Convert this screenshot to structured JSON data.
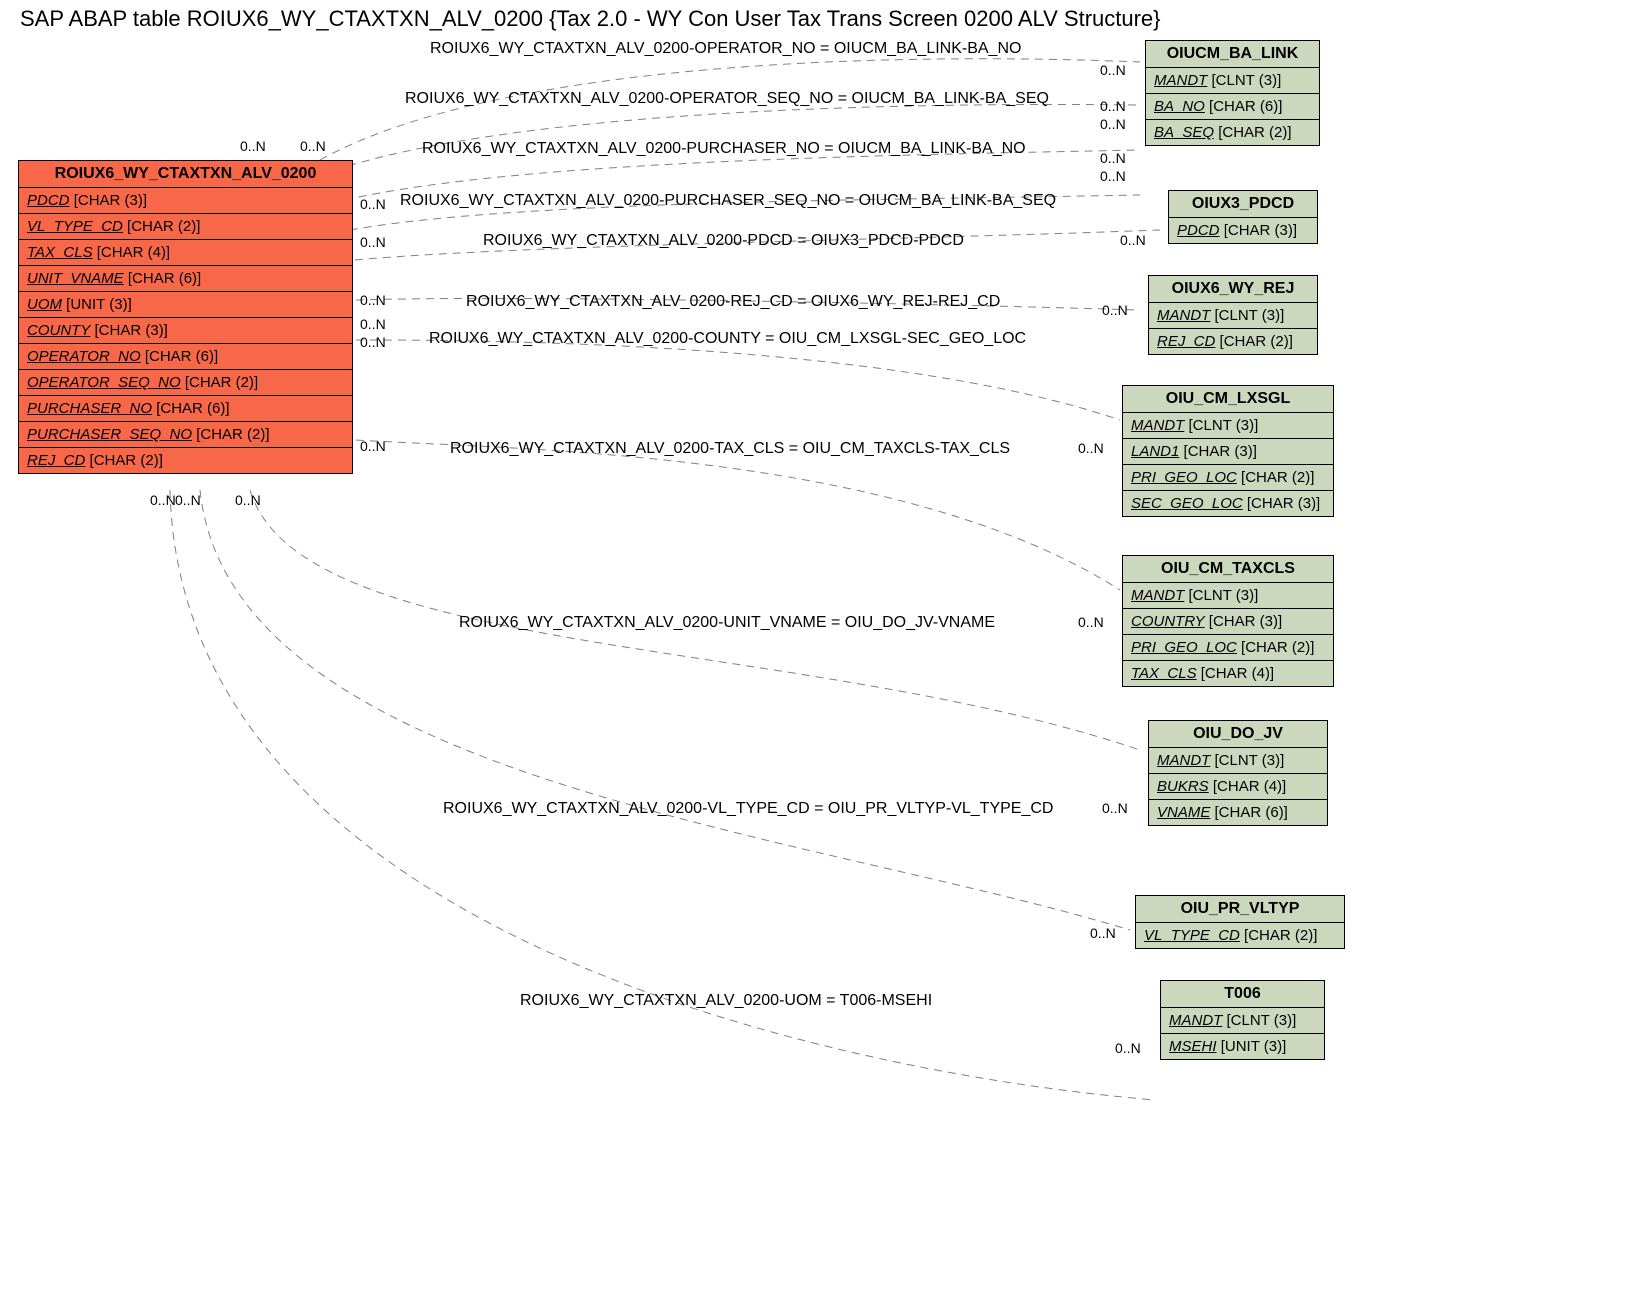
{
  "title": "SAP ABAP table ROIUX6_WY_CTAXTXN_ALV_0200 {Tax 2.0 - WY Con User Tax Trans Screen 0200 ALV Structure}",
  "main": {
    "name": "ROIUX6_WY_CTAXTXN_ALV_0200",
    "fields": [
      {
        "name": "PDCD",
        "type": "[CHAR (3)]",
        "ul": true
      },
      {
        "name": "VL_TYPE_CD",
        "type": "[CHAR (2)]",
        "ul": true
      },
      {
        "name": "TAX_CLS",
        "type": "[CHAR (4)]",
        "ul": true
      },
      {
        "name": "UNIT_VNAME",
        "type": "[CHAR (6)]",
        "ul": true
      },
      {
        "name": "UOM",
        "type": "[UNIT (3)]",
        "ul": true
      },
      {
        "name": "COUNTY",
        "type": "[CHAR (3)]",
        "ul": true
      },
      {
        "name": "OPERATOR_NO",
        "type": "[CHAR (6)]",
        "ul": true
      },
      {
        "name": "OPERATOR_SEQ_NO",
        "type": "[CHAR (2)]",
        "ul": true
      },
      {
        "name": "PURCHASER_NO",
        "type": "[CHAR (6)]",
        "ul": true
      },
      {
        "name": "PURCHASER_SEQ_NO",
        "type": "[CHAR (2)]",
        "ul": true
      },
      {
        "name": "REJ_CD",
        "type": "[CHAR (2)]",
        "ul": true
      }
    ]
  },
  "targets": [
    {
      "name": "OIUCM_BA_LINK",
      "fields": [
        {
          "name": "MANDT",
          "type": "[CLNT (3)]",
          "ul": true
        },
        {
          "name": "BA_NO",
          "type": "[CHAR (6)]",
          "ul": true
        },
        {
          "name": "BA_SEQ",
          "type": "[CHAR (2)]",
          "ul": true
        }
      ]
    },
    {
      "name": "OIUX3_PDCD",
      "fields": [
        {
          "name": "PDCD",
          "type": "[CHAR (3)]",
          "ul": true
        }
      ]
    },
    {
      "name": "OIUX6_WY_REJ",
      "fields": [
        {
          "name": "MANDT",
          "type": "[CLNT (3)]",
          "ul": true
        },
        {
          "name": "REJ_CD",
          "type": "[CHAR (2)]",
          "ul": true
        }
      ]
    },
    {
      "name": "OIU_CM_LXSGL",
      "fields": [
        {
          "name": "MANDT",
          "type": "[CLNT (3)]",
          "ul": true
        },
        {
          "name": "LAND1",
          "type": "[CHAR (3)]",
          "ul": true
        },
        {
          "name": "PRI_GEO_LOC",
          "type": "[CHAR (2)]",
          "ul": true
        },
        {
          "name": "SEC_GEO_LOC",
          "type": "[CHAR (3)]",
          "ul": true
        }
      ]
    },
    {
      "name": "OIU_CM_TAXCLS",
      "fields": [
        {
          "name": "MANDT",
          "type": "[CLNT (3)]",
          "ul": true
        },
        {
          "name": "COUNTRY",
          "type": "[CHAR (3)]",
          "ul": true
        },
        {
          "name": "PRI_GEO_LOC",
          "type": "[CHAR (2)]",
          "ul": true
        },
        {
          "name": "TAX_CLS",
          "type": "[CHAR (4)]",
          "ul": true
        }
      ]
    },
    {
      "name": "OIU_DO_JV",
      "fields": [
        {
          "name": "MANDT",
          "type": "[CLNT (3)]",
          "ul": true
        },
        {
          "name": "BUKRS",
          "type": "[CHAR (4)]",
          "ul": true
        },
        {
          "name": "VNAME",
          "type": "[CHAR (6)]",
          "ul": true
        }
      ]
    },
    {
      "name": "OIU_PR_VLTYP",
      "fields": [
        {
          "name": "VL_TYPE_CD",
          "type": "[CHAR (2)]",
          "ul": true
        }
      ]
    },
    {
      "name": "T006",
      "fields": [
        {
          "name": "MANDT",
          "type": "[CLNT (3)]",
          "ul": true
        },
        {
          "name": "MSEHI",
          "type": "[UNIT (3)]",
          "ul": true
        }
      ]
    }
  ],
  "relations": [
    "ROIUX6_WY_CTAXTXN_ALV_0200-OPERATOR_NO = OIUCM_BA_LINK-BA_NO",
    "ROIUX6_WY_CTAXTXN_ALV_0200-OPERATOR_SEQ_NO = OIUCM_BA_LINK-BA_SEQ",
    "ROIUX6_WY_CTAXTXN_ALV_0200-PURCHASER_NO = OIUCM_BA_LINK-BA_NO",
    "ROIUX6_WY_CTAXTXN_ALV_0200-PURCHASER_SEQ_NO = OIUCM_BA_LINK-BA_SEQ",
    "ROIUX6_WY_CTAXTXN_ALV_0200-PDCD = OIUX3_PDCD-PDCD",
    "ROIUX6_WY_CTAXTXN_ALV_0200-REJ_CD = OIUX6_WY_REJ-REJ_CD",
    "ROIUX6_WY_CTAXTXN_ALV_0200-COUNTY = OIU_CM_LXSGL-SEC_GEO_LOC",
    "ROIUX6_WY_CTAXTXN_ALV_0200-TAX_CLS = OIU_CM_TAXCLS-TAX_CLS",
    "ROIUX6_WY_CTAXTXN_ALV_0200-UNIT_VNAME = OIU_DO_JV-VNAME",
    "ROIUX6_WY_CTAXTXN_ALV_0200-VL_TYPE_CD = OIU_PR_VLTYP-VL_TYPE_CD",
    "ROIUX6_WY_CTAXTXN_ALV_0200-UOM = T006-MSEHI"
  ],
  "card": "0..N"
}
